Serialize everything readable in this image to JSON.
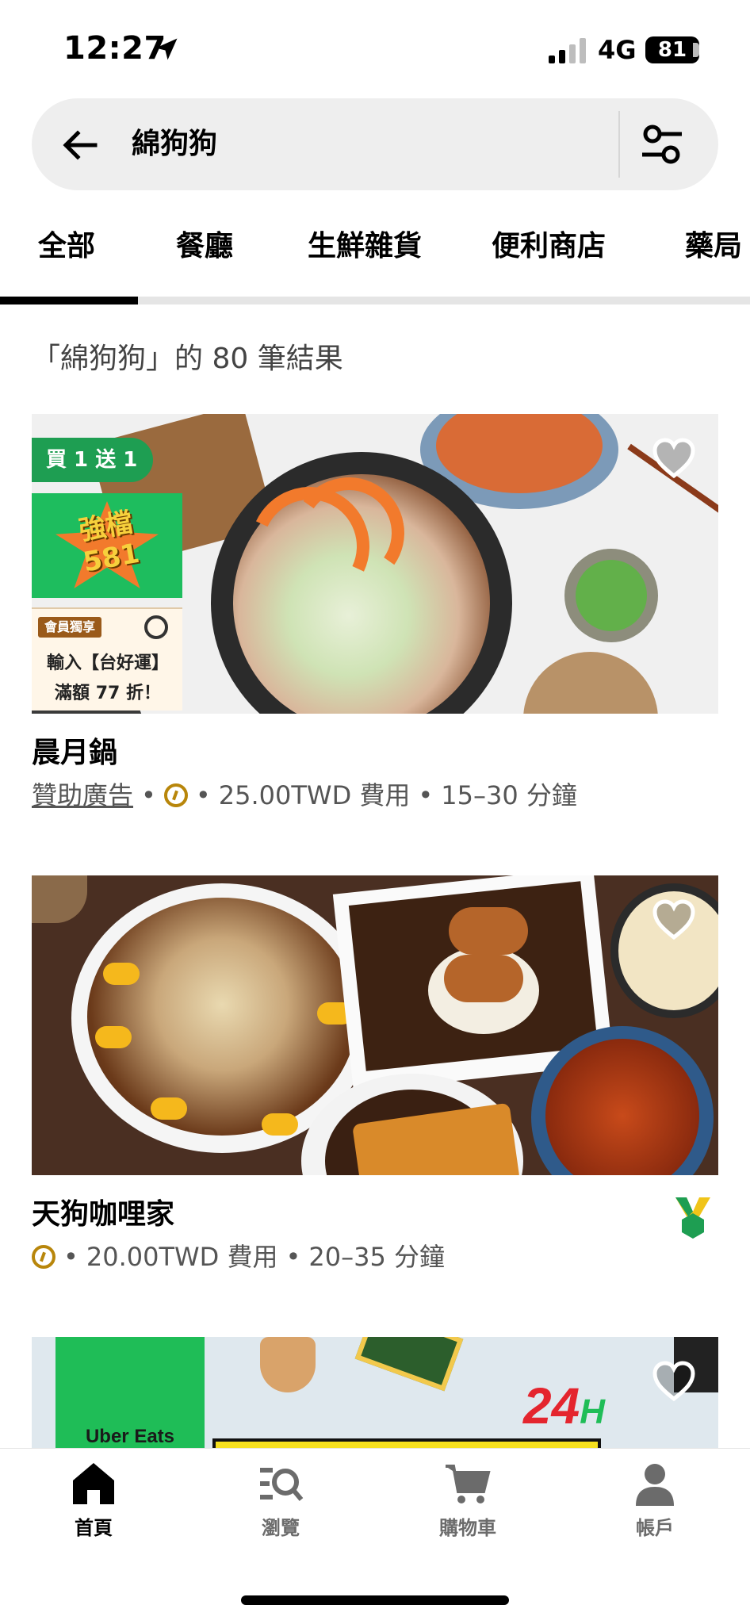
{
  "status_bar": {
    "time": "12:27",
    "network": "4G",
    "battery": "81"
  },
  "search": {
    "query": "綿狗狗"
  },
  "tabs": [
    {
      "label": "全部",
      "active": true
    },
    {
      "label": "餐廳",
      "active": false
    },
    {
      "label": "生鮮雜貨",
      "active": false
    },
    {
      "label": "便利商店",
      "active": false
    },
    {
      "label": "藥局",
      "active": false
    }
  ],
  "results_text": "「綿狗狗」的 80 筆結果",
  "stores": [
    {
      "name": "晨月鍋",
      "sponsored": "贊助廣告",
      "delivery_fee": "25.00TWD 費用",
      "eta": "15–30 分鐘",
      "promo_badge": "買 1 送 1",
      "promo_581_line1": "強檔",
      "promo_581_line2": "581",
      "coupon_tag": "會員獨享",
      "coupon_line1": "輸入【台好運】",
      "coupon_line2": "滿額 77 折！"
    },
    {
      "name": "天狗咖哩家",
      "delivery_fee": "20.00TWD 費用",
      "eta": "20–35 分鐘"
    },
    {
      "ad_brand": "Uber Eats",
      "ad_24": "24",
      "ad_h": "H"
    }
  ],
  "bottom_nav": [
    {
      "label": "首頁",
      "icon": "home-icon",
      "active": true
    },
    {
      "label": "瀏覽",
      "icon": "browse-icon",
      "active": false
    },
    {
      "label": "購物車",
      "icon": "cart-icon",
      "active": false
    },
    {
      "label": "帳戶",
      "icon": "account-icon",
      "active": false
    }
  ],
  "colors": {
    "accent_green": "#1e9e52",
    "uber_one_gold": "#b8860b"
  }
}
